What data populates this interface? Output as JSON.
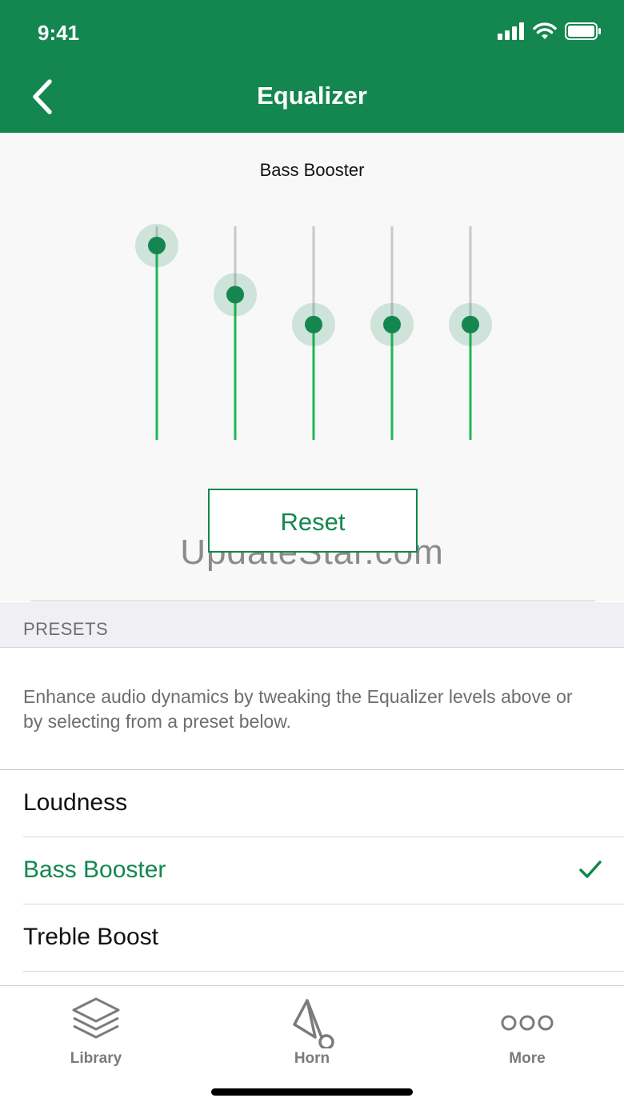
{
  "status": {
    "time": "9:41"
  },
  "header": {
    "title": "Equalizer"
  },
  "equalizer": {
    "preset_name": "Bass Booster",
    "bands": [
      {
        "level": 0.91
      },
      {
        "level": 0.68
      },
      {
        "level": 0.54
      },
      {
        "level": 0.54
      },
      {
        "level": 0.54
      }
    ],
    "reset_label": "Reset"
  },
  "watermark": "UpdateStar.com",
  "presets": {
    "section_title": "PRESETS",
    "description": "Enhance audio dynamics by tweaking the Equalizer levels above or by selecting from a preset below.",
    "items": [
      {
        "label": "Loudness",
        "selected": false
      },
      {
        "label": "Bass Booster",
        "selected": true
      },
      {
        "label": "Treble Boost",
        "selected": false
      }
    ]
  },
  "tabbar": {
    "tabs": [
      {
        "label": "Library",
        "icon": "layers-icon"
      },
      {
        "label": "Horn",
        "icon": "horn-icon"
      },
      {
        "label": "More",
        "icon": "more-icon"
      }
    ]
  },
  "colors": {
    "accent": "#13874f",
    "slider_fill": "#1db954",
    "track": "#c8c8c8"
  }
}
